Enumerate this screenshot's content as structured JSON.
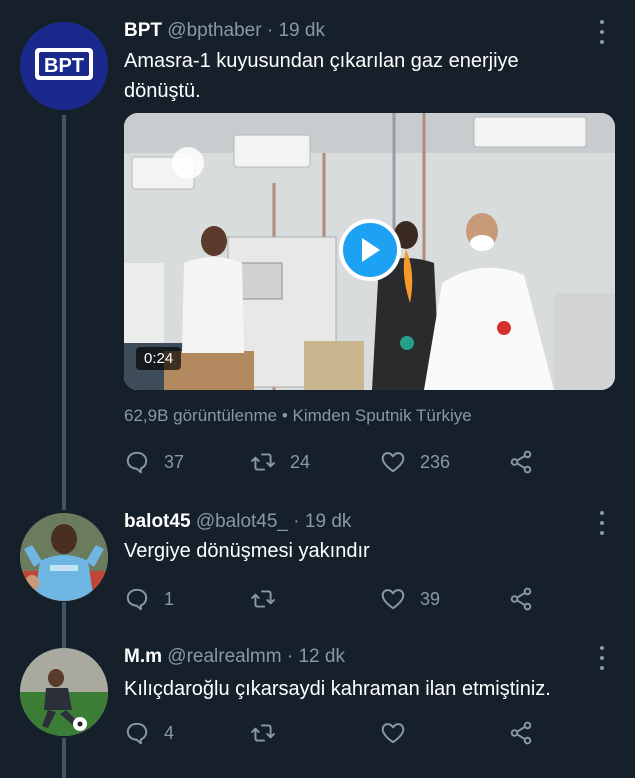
{
  "tweets": [
    {
      "name": "BPT",
      "handle": "@bpthaber",
      "time": "· 19 dk",
      "avatar_text": "BPT",
      "text": "Amasra-1 kuyusundan çıkarılan gaz enerjiye dönüştü.",
      "video": {
        "duration": "0:24"
      },
      "meta": "62,9B görüntülenme • Kimden Sputnik Türkiye",
      "replies": "37",
      "retweets": "24",
      "likes": "236"
    },
    {
      "name": "balot45",
      "handle": "@balot45_",
      "time": "· 19 dk",
      "text": "Vergiye dönüşmesi yakındır",
      "replies": "1",
      "retweets": "",
      "likes": "39"
    },
    {
      "name": "M.m",
      "handle": "@realrealmm",
      "time": "· 12 dk",
      "text": "Kılıçdaroğlu çıkarsaydi kahraman ilan etmiştiniz.",
      "replies": "4",
      "retweets": "",
      "likes": ""
    }
  ],
  "icons": {
    "reply": "reply-icon",
    "retweet": "retweet-icon",
    "like": "heart-icon",
    "share": "share-icon",
    "more": "more-icon"
  },
  "colors": {
    "background": "#15202b",
    "secondary_text": "#8899a6",
    "accent": "#1da1f2",
    "thread_line": "#3d5466",
    "bpt_avatar": "#1a2a8c"
  }
}
